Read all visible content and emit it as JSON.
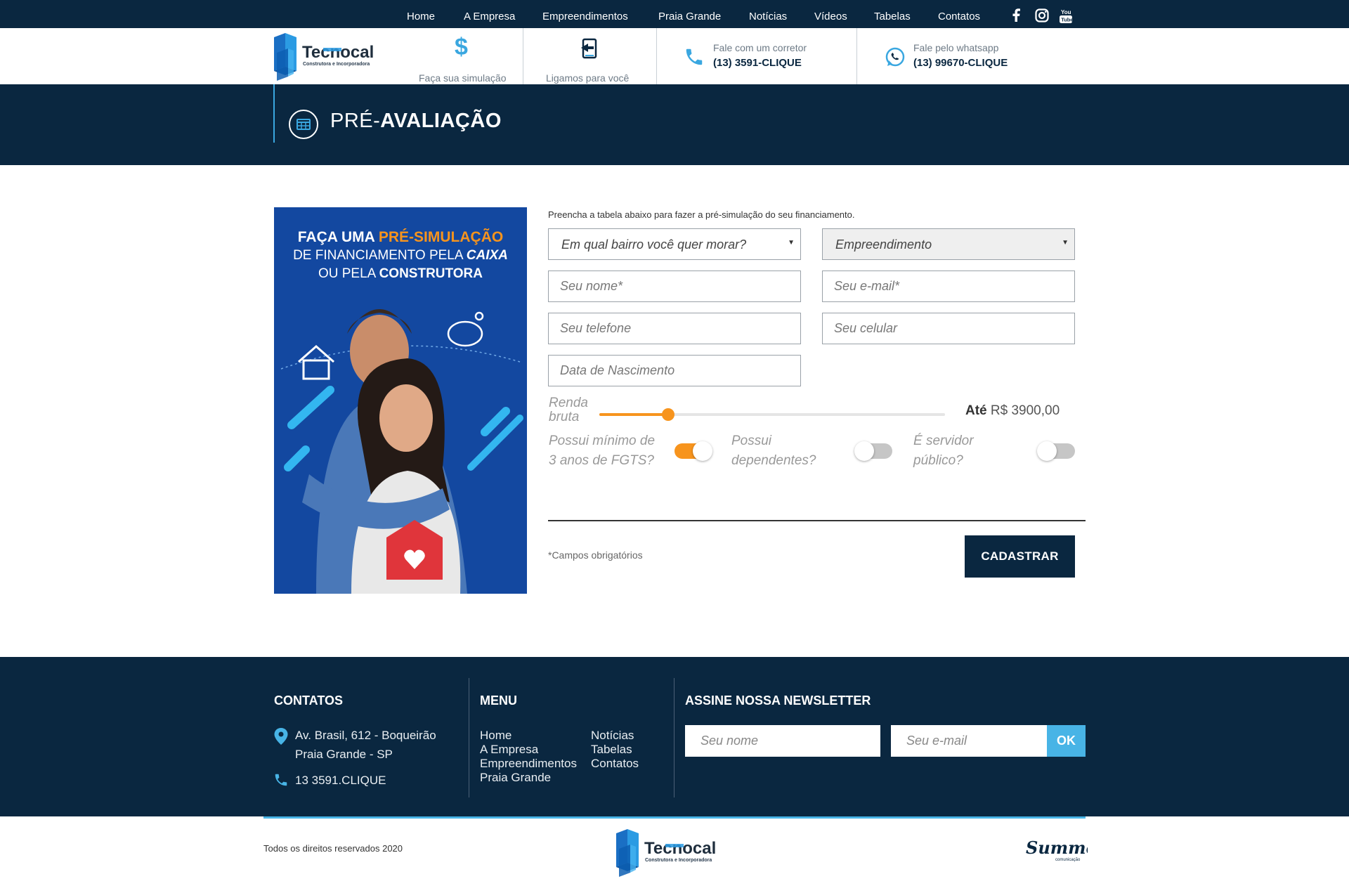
{
  "nav": {
    "items": [
      "Home",
      "A Empresa",
      "Empreendimentos",
      "Praia Grande",
      "Notícias",
      "Vídeos",
      "Tabelas",
      "Contatos"
    ],
    "social": [
      "facebook-icon",
      "instagram-icon",
      "youtube-icon"
    ]
  },
  "header": {
    "logo_text": "Tecnocal",
    "logo_subtitle": "Construtora e Incorporadora",
    "simulacao_label": "Faça sua simulação",
    "ligamos_label": "Ligamos para você",
    "corretor_label": "Fale com um corretor",
    "corretor_phone": "(13) 3591-CLIQUE",
    "whatsapp_label": "Fale pelo whatsapp",
    "whatsapp_phone": "(13) 99670-CLIQUE"
  },
  "banner": {
    "title_light": "PRÉ-",
    "title_bold": "AVALIAÇÃO"
  },
  "promo": {
    "l1a": "FAÇA UMA ",
    "l1b": "PRÉ-SIMULAÇÃO",
    "l2a": "DE FINANCIAMENTO PELA ",
    "l2b": "CAIXA",
    "l3a": "OU PELA ",
    "l3b": "CONSTRUTORA"
  },
  "form": {
    "intro": "Preencha a tabela abaixo para fazer a pré-simulação do seu financiamento.",
    "bairro": "Em qual bairro você quer morar?",
    "empreendimento": "Empreendimento",
    "nome": "Seu nome*",
    "email": "Seu e-mail*",
    "telefone": "Seu telefone",
    "celular": "Seu celular",
    "nascimento": "Data de Nascimento",
    "renda_label_1": "Renda",
    "renda_label_2": "bruta",
    "renda_prefix": "Até",
    "renda_value": "R$ 3900,00",
    "renda_fraction": 0.2,
    "fgts_1": "Possui mínimo de",
    "fgts_2": "3 anos de FGTS?",
    "fgts_on": true,
    "dependentes_1": "Possui",
    "dependentes_2": "dependentes?",
    "dependentes_on": false,
    "servidor_1": "É servidor",
    "servidor_2": "público?",
    "servidor_on": false,
    "required_note": "*Campos obrigatórios",
    "submit": "CADASTRAR"
  },
  "footer": {
    "contatos_title": "CONTATOS",
    "address_1": "Av. Brasil, 612 - Boqueirão",
    "address_2": "Praia Grande - SP",
    "phone": "13 3591.CLIQUE",
    "menu_title": "MENU",
    "menu_col1": [
      "Home",
      "A Empresa",
      "Empreendimentos",
      "Praia Grande"
    ],
    "menu_col2": [
      "Notícias",
      "Tabelas",
      "Contatos"
    ],
    "newsletter_title": "ASSINE NOSSA NEWSLETTER",
    "newsletter_name": "Seu nome",
    "newsletter_email": "Seu e-mail",
    "newsletter_ok": "OK"
  },
  "bottom": {
    "copyright": "Todos os direitos reservados 2020",
    "agency": "Summer",
    "agency_sub": "comunicação"
  },
  "colors": {
    "navy": "#0a2740",
    "accent": "#48b4e6",
    "orange": "#f7941d",
    "promo_blue": "#1348a0"
  }
}
